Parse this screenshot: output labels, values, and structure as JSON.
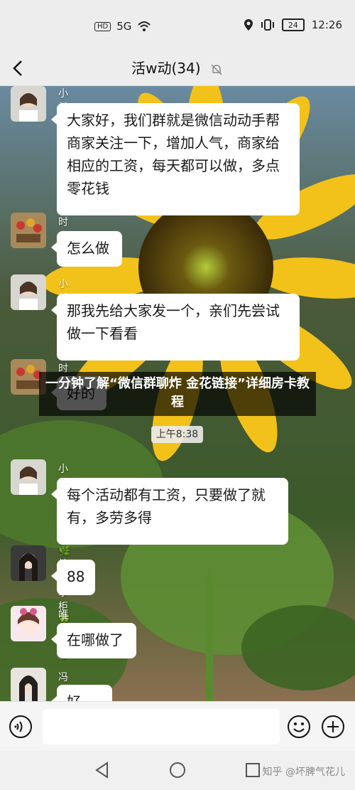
{
  "status_bar": {
    "left_indicators": "HD 5G",
    "time": "12:26",
    "battery": "24"
  },
  "header": {
    "title": "活w动(34)"
  },
  "messages": [
    {
      "name": "小希",
      "text": "大家好，我们群就是微信动动手帮商家关注一下，增加人气，商家给相应的工资，每天都可以做，多点零花钱"
    },
    {
      "name": "时光",
      "text": "怎么做"
    },
    {
      "name": "小希",
      "text": "那我先给大家发一个，亲们先尝试做一下看看"
    },
    {
      "name": "时光",
      "text": "好的"
    },
    {
      "name": "小希",
      "text": "每个活动都有工资，只要做了就有，多劳多得"
    },
    {
      "name": "柠檬掌柜",
      "text": "88"
    },
    {
      "name": "唯衣",
      "text": "在哪做了"
    },
    {
      "name": "冯三妹",
      "text": "好"
    }
  ],
  "time_chip": "上午8:38",
  "overlay_text": "一分钟了解“微信群聊炸 金花链接”详细房卡教程",
  "input": {
    "placeholder": ""
  },
  "watermark": "知乎 @坏脾气花儿"
}
